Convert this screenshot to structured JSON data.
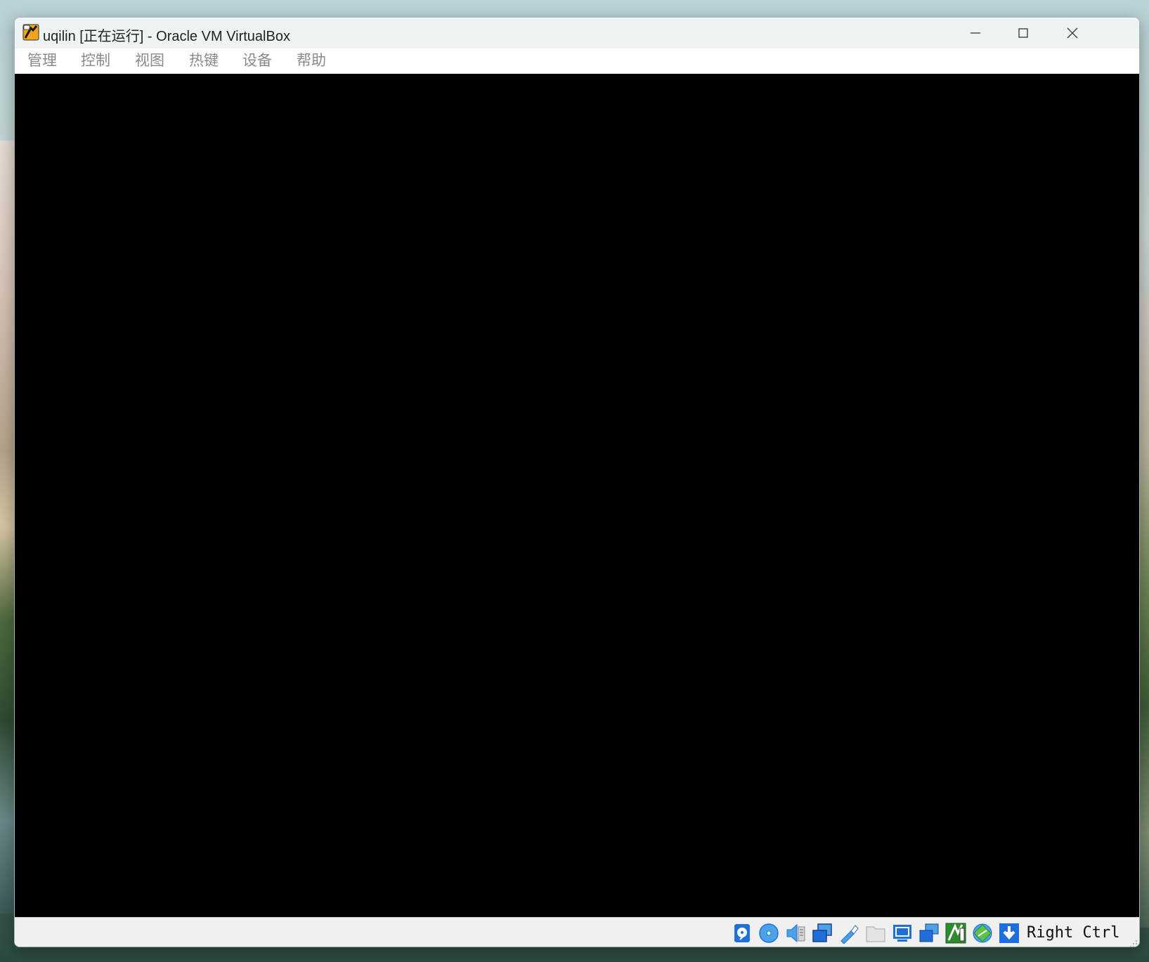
{
  "window": {
    "title": "uqilin [正在运行] - Oracle VM VirtualBox"
  },
  "menu": {
    "items": [
      {
        "label": "管理"
      },
      {
        "label": "控制"
      },
      {
        "label": "视图"
      },
      {
        "label": "热键"
      },
      {
        "label": "设备"
      },
      {
        "label": "帮助"
      }
    ]
  },
  "statusbar": {
    "icons": [
      "hard-disk-icon",
      "optical-drive-icon",
      "audio-icon",
      "network-icon",
      "usb-icon",
      "shared-folders-icon",
      "display-icon",
      "recording-icon",
      "cpu-icon",
      "guest-additions-icon",
      "mouse-integration-icon"
    ],
    "host_key": "Right Ctrl"
  },
  "colors": {
    "accent": "#1e6fd9",
    "screen": "#000000"
  }
}
